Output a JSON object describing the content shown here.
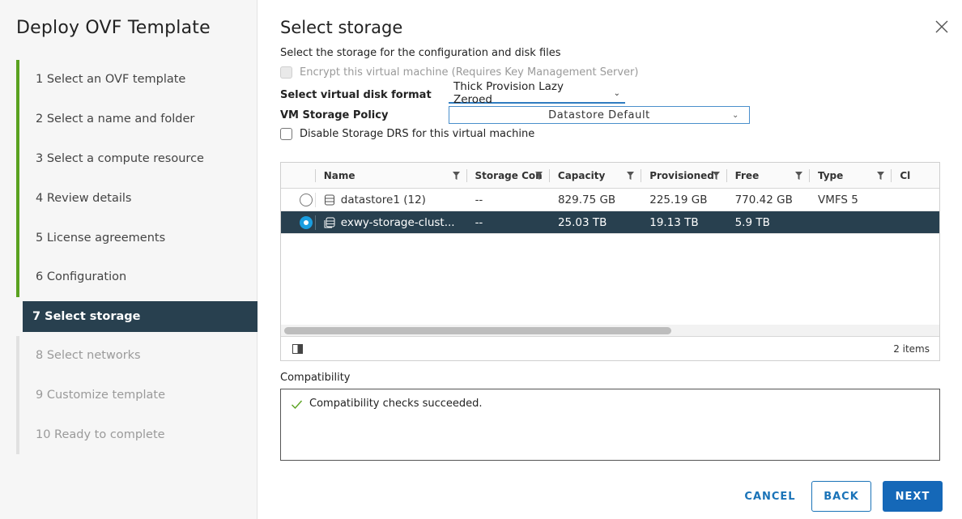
{
  "sidebar": {
    "title": "Deploy OVF Template",
    "steps": [
      {
        "label": "1  Select an OVF template"
      },
      {
        "label": "2  Select a name and folder"
      },
      {
        "label": "3  Select a compute resource"
      },
      {
        "label": "4  Review details"
      },
      {
        "label": "5  License agreements"
      },
      {
        "label": "6  Configuration"
      },
      {
        "label": "7  Select storage"
      },
      {
        "label": "8  Select networks"
      },
      {
        "label": "9  Customize template"
      },
      {
        "label": "10  Ready to complete"
      }
    ]
  },
  "main": {
    "title": "Select storage",
    "subtitle": "Select the storage for the configuration and disk files",
    "encrypt_label": "Encrypt this virtual machine (Requires Key Management Server)",
    "disk_format_label": "Select virtual disk format",
    "disk_format_value": "Thick Provision Lazy Zeroed",
    "storage_policy_label": "VM Storage Policy",
    "storage_policy_value": "Datastore Default",
    "disable_drs_label": "Disable Storage DRS for this virtual machine",
    "grid": {
      "columns": [
        "Name",
        "Storage Con",
        "Capacity",
        "Provisioned",
        "Free",
        "Type",
        "Cl"
      ],
      "rows": [
        {
          "name": "datastore1 (12)",
          "storage_compat": "--",
          "capacity": "829.75 GB",
          "provisioned": "225.19 GB",
          "free": "770.42 GB",
          "type": "VMFS 5",
          "selected": false
        },
        {
          "name": "exwy-storage-clust...",
          "storage_compat": "--",
          "capacity": "25.03 TB",
          "provisioned": "19.13 TB",
          "free": "5.9 TB",
          "type": "",
          "selected": true
        }
      ],
      "item_count": "2 items"
    },
    "compatibility_label": "Compatibility",
    "compatibility_message": "Compatibility checks succeeded."
  },
  "buttons": {
    "cancel": "CANCEL",
    "back": "BACK",
    "next": "NEXT"
  },
  "colors": {
    "active_step": "#28404f",
    "done_bar": "#5aa220",
    "primary": "#1568b8",
    "check": "#5aa220"
  }
}
